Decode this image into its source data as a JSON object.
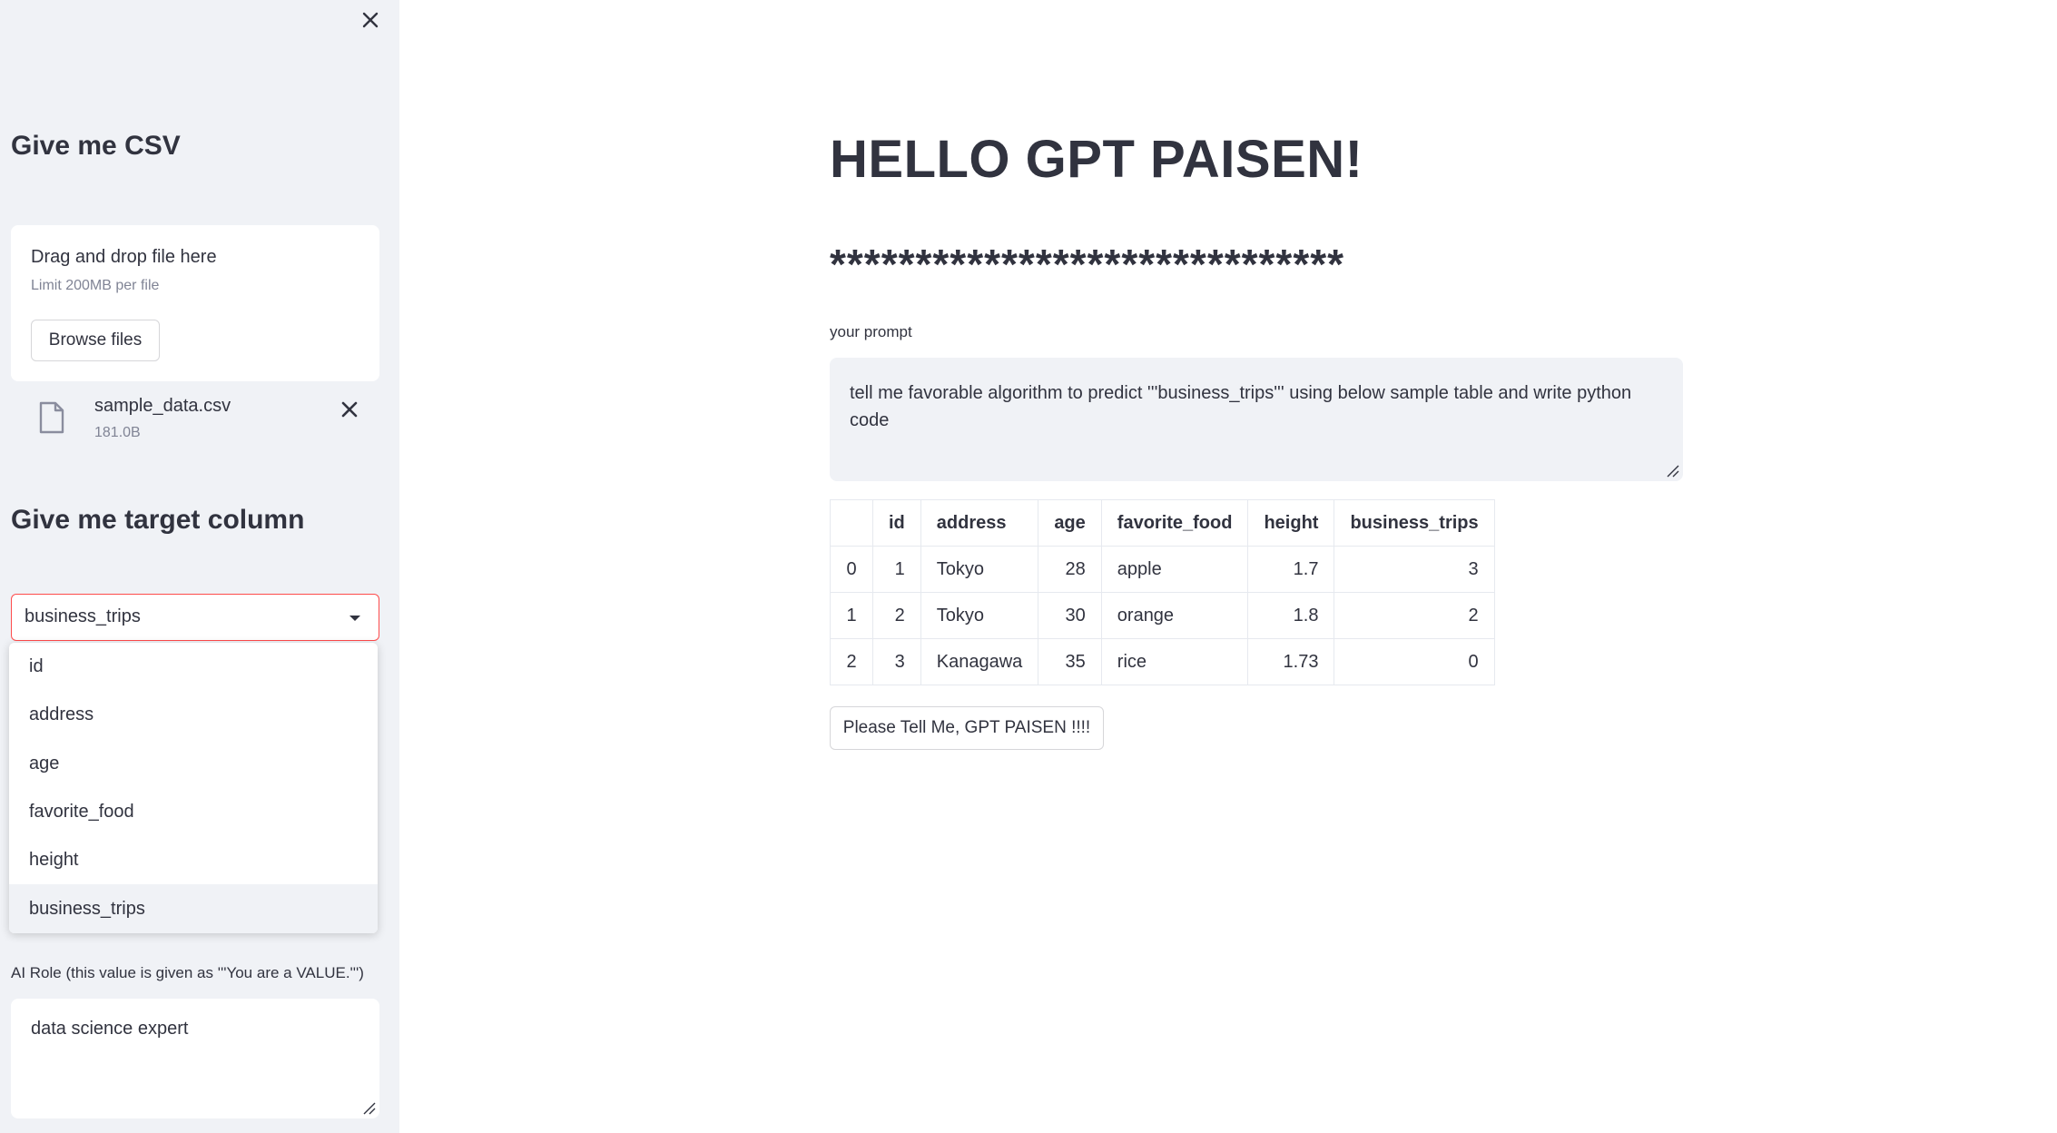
{
  "sidebar": {
    "close_icon": "close-icon",
    "csv_heading": "Give me CSV",
    "uploader": {
      "drag_text": "Drag and drop file here",
      "limit_text": "Limit 200MB per file",
      "browse_label": "Browse files"
    },
    "file": {
      "name": "sample_data.csv",
      "size": "181.0B",
      "icon": "file-icon",
      "delete_icon": "close-icon"
    },
    "target_heading": "Give me target column",
    "target_select": {
      "value": "business_trips",
      "options": [
        "id",
        "address",
        "age",
        "favorite_food",
        "height",
        "business_trips"
      ]
    },
    "role_label": "AI Role (this value is given as '''You are a VALUE.''')",
    "role_value": "data science expert"
  },
  "main": {
    "title": "HELLO GPT PAISEN!",
    "stars": "******************************",
    "prompt_label": "your prompt",
    "prompt_value": "tell me favorable algorithm to predict '''business_trips''' using below sample table and write python code",
    "table": {
      "headers": [
        "",
        "id",
        "address",
        "age",
        "favorite_food",
        "height",
        "business_trips"
      ],
      "rows": [
        [
          "0",
          "1",
          "Tokyo",
          "28",
          "apple",
          "1.7",
          "3"
        ],
        [
          "1",
          "2",
          "Tokyo",
          "30",
          "orange",
          "1.8",
          "2"
        ],
        [
          "2",
          "3",
          "Kanagawa",
          "35",
          "rice",
          "1.73",
          "0"
        ]
      ]
    },
    "submit_label": "Please Tell Me, GPT PAISEN !!!!"
  },
  "colors": {
    "sidebar_bg": "#f0f2f6",
    "text": "#31333f",
    "focus_border": "#ff4b4b",
    "muted": "#808495"
  }
}
